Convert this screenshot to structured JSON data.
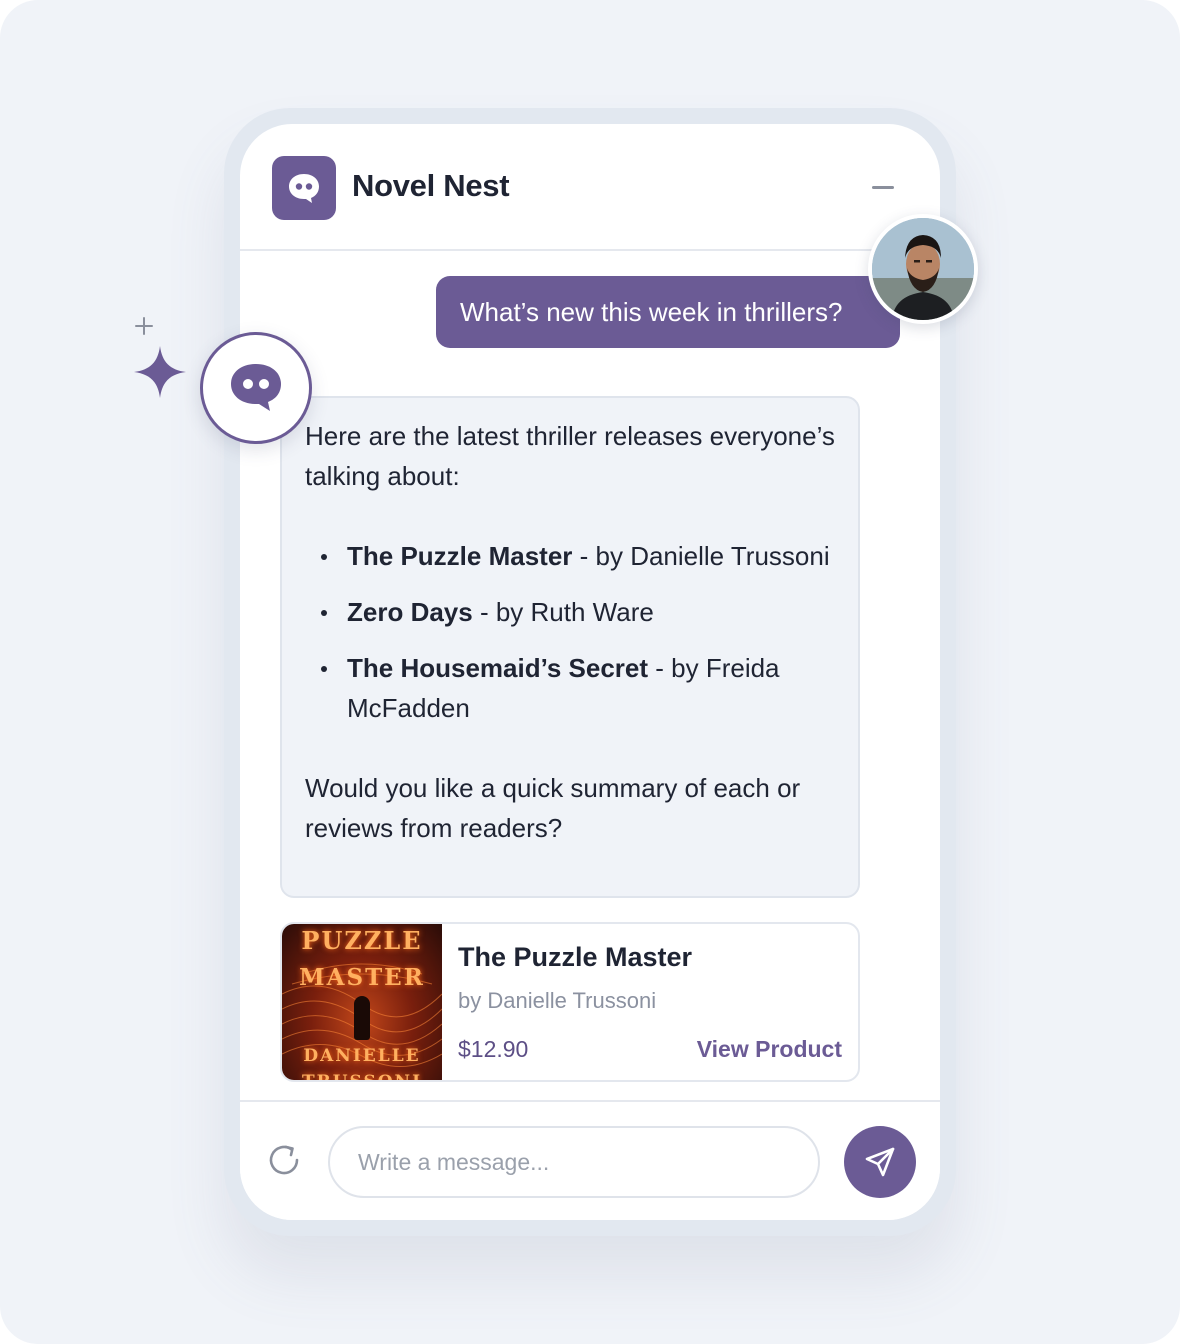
{
  "app": {
    "title": "Novel Nest"
  },
  "chat": {
    "user_message": "What’s new this week in thrillers?",
    "bot_intro": "Here are the latest thriller releases everyone’s talking about:",
    "books": [
      {
        "title": "The Puzzle Master",
        "suffix": " - by Danielle Trussoni"
      },
      {
        "title": "Zero Days",
        "suffix": " - by Ruth Ware"
      },
      {
        "title": "The Housemaid’s Secret",
        "suffix": " - by Freida McFadden"
      }
    ],
    "bot_outro": "Would you like a quick summary of each or reviews from readers?"
  },
  "product": {
    "title": "The Puzzle Master",
    "author": "by Danielle Trussoni",
    "price": "$12.90",
    "cta": "View Product",
    "cover": {
      "line1": "PUZZLE",
      "line2": "MASTER",
      "author": "DANIELLE",
      "author2": "TRUSSONI"
    }
  },
  "composer": {
    "placeholder": "Write a message..."
  },
  "icons": {
    "logo": "chat-bubble-icon",
    "minimize": "minimize-icon",
    "refresh": "refresh-icon",
    "send": "send-icon",
    "sparkle": "sparkle-icon"
  },
  "colors": {
    "accent": "#6b5b95",
    "background": "#f0f3f8",
    "text": "#1f2433",
    "muted": "#8b91a0"
  }
}
